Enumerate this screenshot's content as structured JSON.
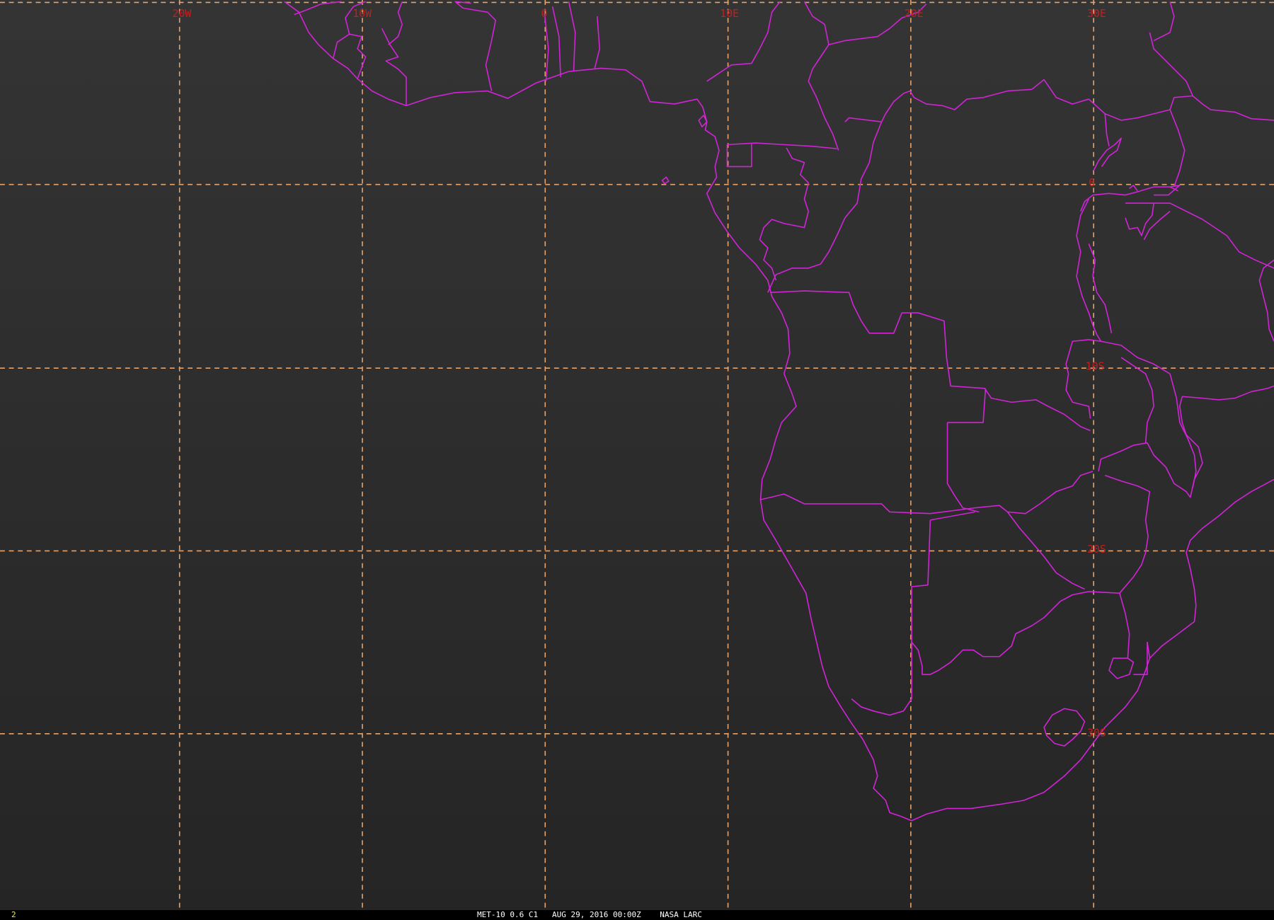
{
  "map": {
    "title": "MET-10 0.6 C1   AUG 29, 2016 00:00Z    NASA LARC",
    "frame_number": "2",
    "colors": {
      "background": "#2b2b2b",
      "coastline": "#d024d6",
      "grid": "#e6a46c",
      "grid_label": "#c2201e",
      "frame_number": "#e8e84a",
      "status_bar": "#000000"
    },
    "longitude_labels": [
      "20W",
      "10W",
      "0",
      "10E",
      "20E",
      "30E"
    ],
    "latitude_labels": [
      "0",
      "10S",
      "20S",
      "30S"
    ],
    "longitude_lines_deg": [
      -20,
      -10,
      0,
      10,
      20,
      30
    ],
    "latitude_lines_deg": [
      0,
      -10,
      -20,
      -30,
      10
    ]
  }
}
